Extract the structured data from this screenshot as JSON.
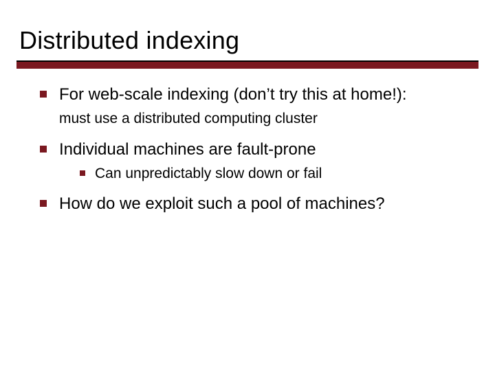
{
  "title": "Distributed indexing",
  "bullets": {
    "item0": {
      "text": "For web-scale indexing (don’t try this at home!):",
      "sub": "must use a distributed computing cluster"
    },
    "item1": {
      "text": "Individual machines are fault-prone",
      "child": "Can unpredictably slow down or fail"
    },
    "item2": {
      "text": "How do we exploit such a pool of machines?"
    }
  },
  "accent_color": "#7a1820"
}
